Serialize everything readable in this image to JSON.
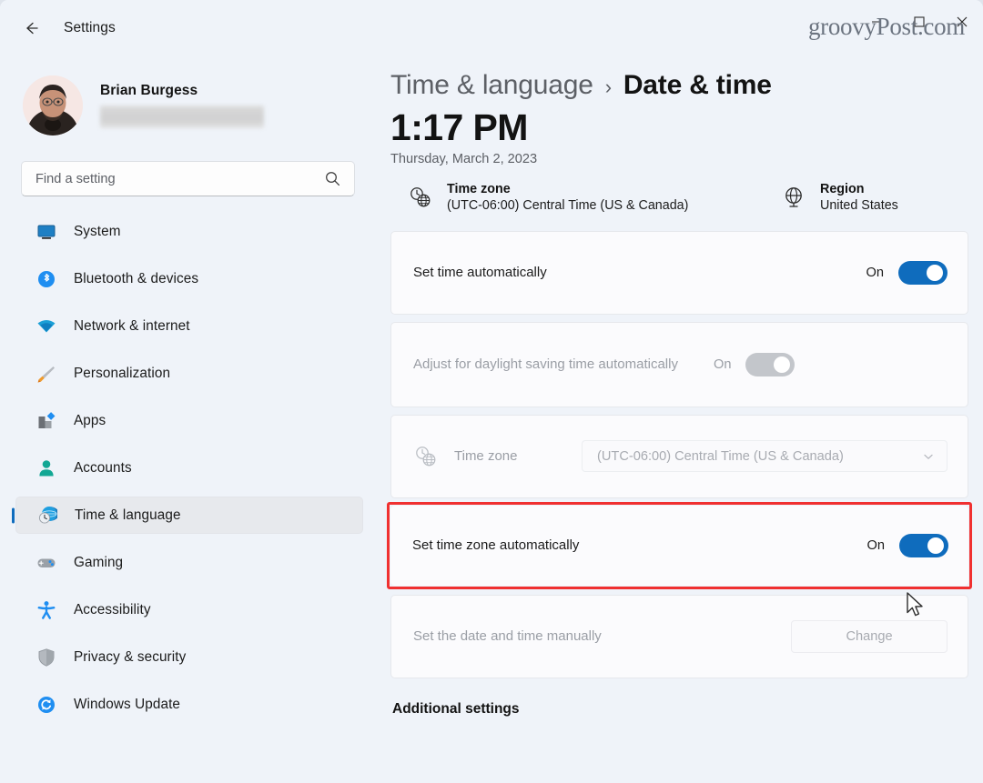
{
  "window": {
    "title": "Settings",
    "back_icon": "back-arrow-icon",
    "minimize_label": "—",
    "maximize_label": "□",
    "close_label": "✕",
    "watermark": "groovyPost.com"
  },
  "sidebar": {
    "profile": {
      "name": "Brian Burgess",
      "email_redacted": ""
    },
    "search": {
      "placeholder": "Find a setting",
      "value": "",
      "icon": "search-icon"
    },
    "items": [
      {
        "label": "System",
        "icon": "monitor-icon",
        "selected": false
      },
      {
        "label": "Bluetooth & devices",
        "icon": "bluetooth-icon",
        "selected": false
      },
      {
        "label": "Network & internet",
        "icon": "wifi-icon",
        "selected": false
      },
      {
        "label": "Personalization",
        "icon": "paintbrush-icon",
        "selected": false
      },
      {
        "label": "Apps",
        "icon": "apps-icon",
        "selected": false
      },
      {
        "label": "Accounts",
        "icon": "person-icon",
        "selected": false
      },
      {
        "label": "Time & language",
        "icon": "clock-globe-icon",
        "selected": true
      },
      {
        "label": "Gaming",
        "icon": "gamepad-icon",
        "selected": false
      },
      {
        "label": "Accessibility",
        "icon": "accessibility-icon",
        "selected": false
      },
      {
        "label": "Privacy & security",
        "icon": "shield-icon",
        "selected": false
      },
      {
        "label": "Windows Update",
        "icon": "refresh-icon",
        "selected": false
      }
    ]
  },
  "main": {
    "breadcrumb": {
      "parent": "Time & language",
      "separator": "›",
      "current": "Date & time"
    },
    "clock": {
      "time": "1:17 PM",
      "date": "Thursday, March 2, 2023"
    },
    "info": {
      "timezone": {
        "title": "Time zone",
        "value": "(UTC-06:00) Central Time (US & Canada)",
        "icon": "clock-globe-icon"
      },
      "region": {
        "title": "Region",
        "value": "United States",
        "icon": "globe-icon"
      }
    },
    "settings": {
      "set_time_auto": {
        "label": "Set time automatically",
        "state": "On",
        "toggle_on": true,
        "disabled": false
      },
      "adjust_dst": {
        "label": "Adjust for daylight saving time automatically",
        "state": "On",
        "toggle_on": true,
        "disabled": true
      },
      "timezone_row": {
        "label": "Time zone",
        "selected": "(UTC-06:00) Central Time (US & Canada)",
        "icon": "clock-globe-icon",
        "chevron": "chevron-down-icon",
        "disabled": true
      },
      "set_tz_auto": {
        "label": "Set time zone automatically",
        "state": "On",
        "toggle_on": true,
        "disabled": false,
        "highlighted": true,
        "highlight_color": "#f03030"
      },
      "set_manual": {
        "label": "Set the date and time manually",
        "button_label": "Change",
        "disabled": true
      }
    },
    "additional_settings_heading": "Additional settings"
  },
  "colors": {
    "page_bg": "#eff3f9",
    "card_bg": "#fbfbfd",
    "accent": "#0f6cbd",
    "highlight_red": "#f03030",
    "text_primary": "#1b1b1b",
    "text_secondary": "#5d6066",
    "text_disabled": "#9a9ea5"
  }
}
